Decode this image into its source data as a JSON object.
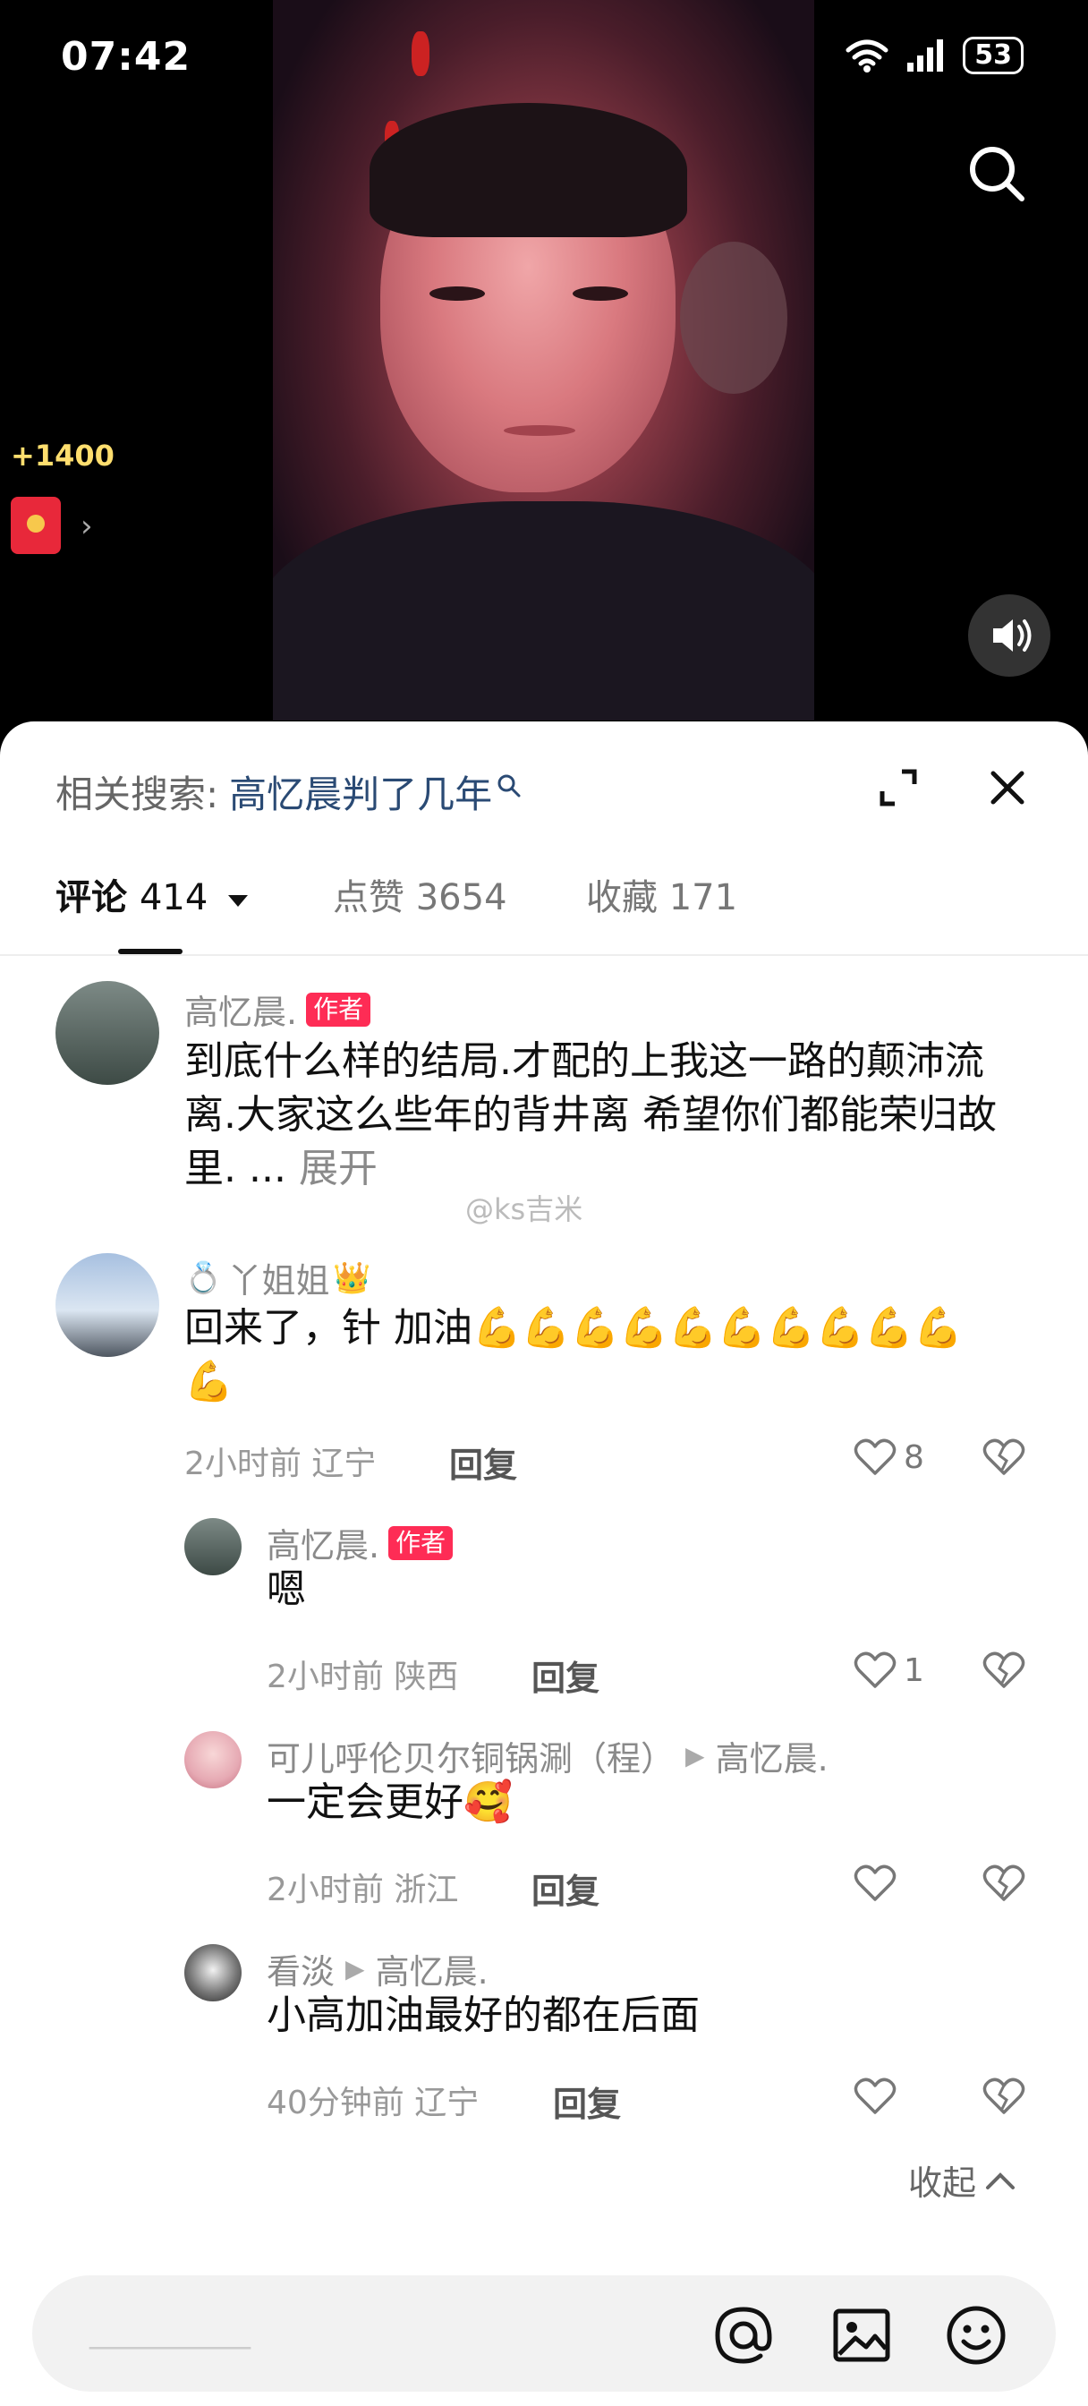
{
  "status_bar": {
    "time": "07:42",
    "battery": "53"
  },
  "video": {
    "reward_label": "+1400"
  },
  "related_search": {
    "prefix": "相关搜索:",
    "term": "高忆晨判了几年"
  },
  "tabs": [
    {
      "label": "评论",
      "count": "414"
    },
    {
      "label": "点赞",
      "count": "3654"
    },
    {
      "label": "收藏",
      "count": "171"
    }
  ],
  "comments": {
    "pinned": {
      "name": "高忆晨.",
      "badge": "作者",
      "text": "到底什么样的结局.才配的上我这一路的颠沛流离.大家这么些年的背井离 希望你们都能荣归故里. ...",
      "expand": "展开",
      "watermark": "@ks吉米"
    },
    "main": {
      "name": "丫姐姐",
      "text": "回来了，针 加油💪💪💪💪💪💪💪💪💪💪💪",
      "time": "2小时前",
      "location": "辽宁",
      "reply": "回复",
      "likes": "8"
    },
    "replies": [
      {
        "name": "高忆晨.",
        "badge": "作者",
        "text": "嗯",
        "time": "2小时前",
        "location": "陕西",
        "reply": "回复",
        "likes": "1"
      },
      {
        "name": "可儿呼伦贝尔铜锅涮（程）",
        "to": "高忆晨.",
        "text": "一定会更好🥰",
        "time": "2小时前",
        "location": "浙江",
        "reply": "回复",
        "likes": ""
      },
      {
        "name": "看淡",
        "to": "高忆晨.",
        "text": "小高加油最好的都在后面",
        "time": "40分钟前",
        "location": "辽宁",
        "reply": "回复",
        "likes": ""
      }
    ],
    "collapse": "收起"
  },
  "colors": {
    "accent": "#fe2c55",
    "related_term": "#2a4a74"
  }
}
